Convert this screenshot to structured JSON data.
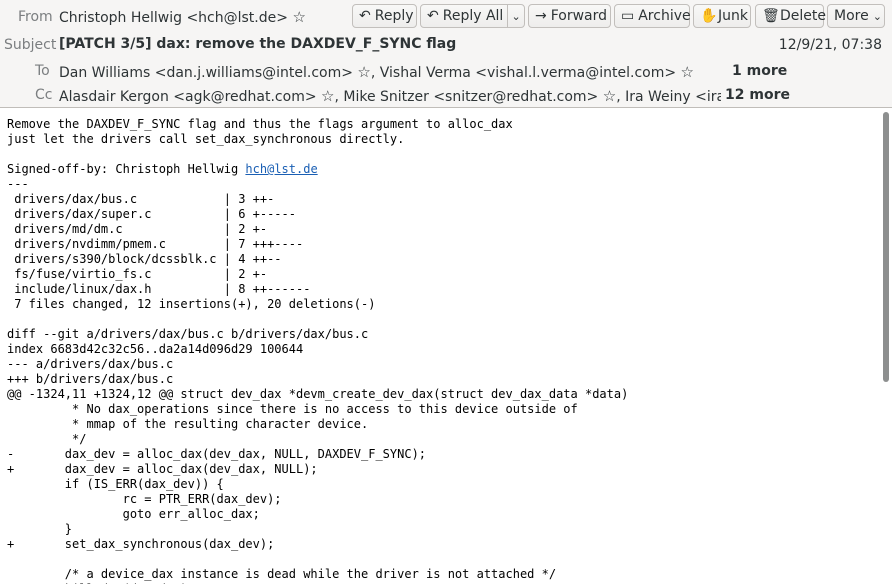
{
  "header": {
    "from_label": "From",
    "from_value": "Christoph Hellwig <hch@lst.de>",
    "subject_label": "Subject",
    "subject": "[PATCH 3/5] dax: remove the DAXDEV_F_SYNC flag",
    "date": "12/9/21, 07:38",
    "to_label": "To",
    "to_1": "Dan Williams <dan.j.williams@intel.com>",
    "to_2": "Vishal Verma <vishal.l.verma@intel.com>",
    "to_more": "1 more",
    "cc_label": "Cc",
    "cc_1": "Alasdair Kergon <agk@redhat.com>",
    "cc_2": "Mike Snitzer <snitzer@redhat.com>",
    "cc_3": "Ira Weiny <ira.weiny@",
    "cc_more": "12 more"
  },
  "toolbar": {
    "reply": "Reply",
    "reply_all": "Reply All",
    "forward": "Forward",
    "archive": "Archive",
    "junk": "Junk",
    "delete": "Delete",
    "more": "More"
  },
  "message": {
    "line_before_link": "Remove the DAXDEV_F_SYNC flag and thus the flags argument to alloc_dax\njust let the drivers call set_dax_synchronous directly.\n\nSigned-off-by: Christoph Hellwig ",
    "signoff_email": "hch@lst.de",
    "body": "\n---\n drivers/dax/bus.c            | 3 ++-\n drivers/dax/super.c          | 6 +-----\n drivers/md/dm.c              | 2 +-\n drivers/nvdimm/pmem.c        | 7 +++----\n drivers/s390/block/dcssblk.c | 4 ++--\n fs/fuse/virtio_fs.c          | 2 +-\n include/linux/dax.h          | 8 ++------\n 7 files changed, 12 insertions(+), 20 deletions(-)\n\ndiff --git a/drivers/dax/bus.c b/drivers/dax/bus.c\nindex 6683d42c32c56..da2a14d096d29 100644\n--- a/drivers/dax/bus.c\n+++ b/drivers/dax/bus.c\n@@ -1324,11 +1324,12 @@ struct dev_dax *devm_create_dev_dax(struct dev_dax_data *data)\n         * No dax_operations since there is no access to this device outside of\n         * mmap of the resulting character device.\n         */\n-       dax_dev = alloc_dax(dev_dax, NULL, DAXDEV_F_SYNC);\n+       dax_dev = alloc_dax(dev_dax, NULL);\n        if (IS_ERR(dax_dev)) {\n                rc = PTR_ERR(dax_dev);\n                goto err_alloc_dax;\n        }\n+       set_dax_synchronous(dax_dev);\n\n        /* a device_dax instance is dead while the driver is not attached */\n        kill_dax(dax_dev);"
  }
}
